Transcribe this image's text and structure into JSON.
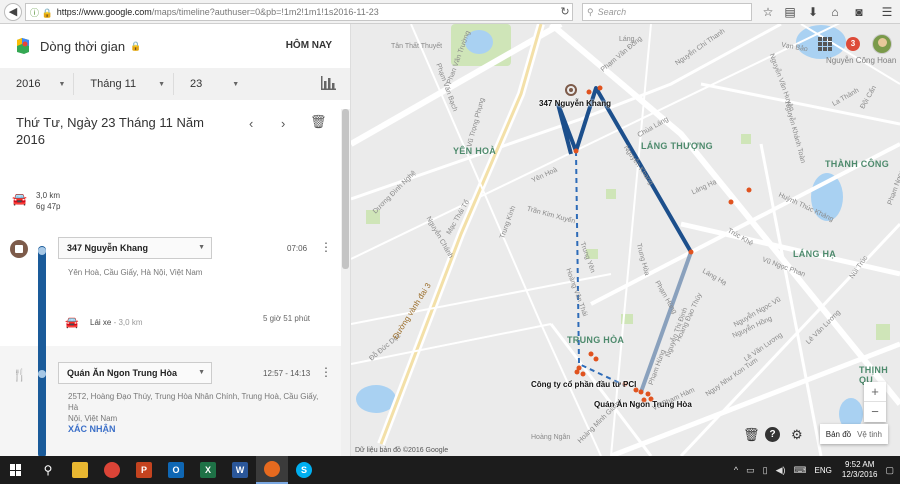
{
  "browser": {
    "url_host": "https://www.google.com",
    "url_path": "/maps/timeline?authuser=0&pb=!1m2!1m1!1s2016-11-23",
    "search_placeholder": "Search"
  },
  "sidebar": {
    "title": "Dòng thời gian",
    "today_label": "HÔM NAY",
    "year": "2016",
    "month": "Tháng 11",
    "day": "23",
    "day_title": "Thứ Tư, Ngày 23 Tháng 11 Năm 2016",
    "summary_distance": "3,0 km",
    "summary_duration": "6g 47p",
    "stops": [
      {
        "name": "347 Nguyễn Khang",
        "time": "07:06",
        "address": "Yên Hoà, Cầu Giấy, Hà Nội, Việt Nam"
      },
      {
        "name": "Quán Ăn Ngon Trung Hòa",
        "time": "12:57 - 14:13",
        "address_line1": "25T2, Hoàng Đạo Thúy, Trung Hòa Nhân Chính, Trung Hoà, Cầu Giấy, Hà",
        "address_line2": "Nội, Việt Nam",
        "confirm_label": "XÁC NHẬN"
      }
    ],
    "drive": {
      "label": "Lái xe",
      "distance": "3,0 km",
      "duration": "5 giờ 51 phút"
    }
  },
  "map": {
    "notification_count": "3",
    "user_name": "Nguyễn Công Hoan",
    "areas": [
      "YÊN HOÀ",
      "LÁNG THƯỢNG",
      "THÀNH CÔNG",
      "LÁNG HẠ",
      "TRUNG HÒA",
      "THỊNH QU"
    ],
    "places": [
      "347 Nguyễn Khang",
      "Công ty cổ phần đầu tư PCI",
      "Quán Ăn Ngon Trung Hòa"
    ],
    "streets": [
      "Phạm Văn Đồng",
      "Tân Thất Thuyết",
      "Phạm Văn Bạch",
      "Dương Đình Nghệ",
      "Mạc Thái Tổ",
      "Nguyễn Chánh",
      "Trung Kính",
      "Trần Kim Xuyến",
      "Yên Hoà",
      "Nguyễn Khang",
      "Chùa Láng",
      "Nguyễn Chí Thanh",
      "Láng",
      "Nguyễn Văn Huyên",
      "Nguyễn Khánh Toàn",
      "Huỳnh Thúc Kháng",
      "Trúc Khê",
      "Vũ Ngọc Phan",
      "Phạm Hùng",
      "Nguyễn Ngọc Vũ",
      "Lê Văn Lương",
      "Hoàng Ngân",
      "Hoàng Minh Giám",
      "Đỗ Đức Dục",
      "Đường vành đai 3",
      "Trung Hòa",
      "Nguyễn Thị Định",
      "Phạm Hùng",
      "Láng Hạ",
      "Láng Hạ",
      "Trung Yên",
      "Vũ Phạm Hàm",
      "Lê Văn Lương",
      "Vạn Bảo",
      "La Thành",
      "Núi Trúc",
      "Đội Cấn",
      "Phạm Ngọc Thạch",
      "Nguyễn Hồng",
      "Phan Văn Trường",
      "Vũ Trọng Phụng",
      "Hoàng Đạo Thúy",
      "Ngụy Như Kon Tum",
      "Hoàng Văn Thái"
    ],
    "zoom_in": "+",
    "zoom_out": "−",
    "maptype_map": "Bản đồ",
    "maptype_sat": "Vệ tinh",
    "attribution": "Dữ liệu bản đồ ©2016 Google",
    "route_colors": {
      "route": "#1c4f8c",
      "walk": "#2d6bb8",
      "stop_dot": "#e0531f"
    }
  },
  "taskbar": {
    "time": "9:52 AM",
    "date": "12/3/2016",
    "lang": "ENG"
  }
}
